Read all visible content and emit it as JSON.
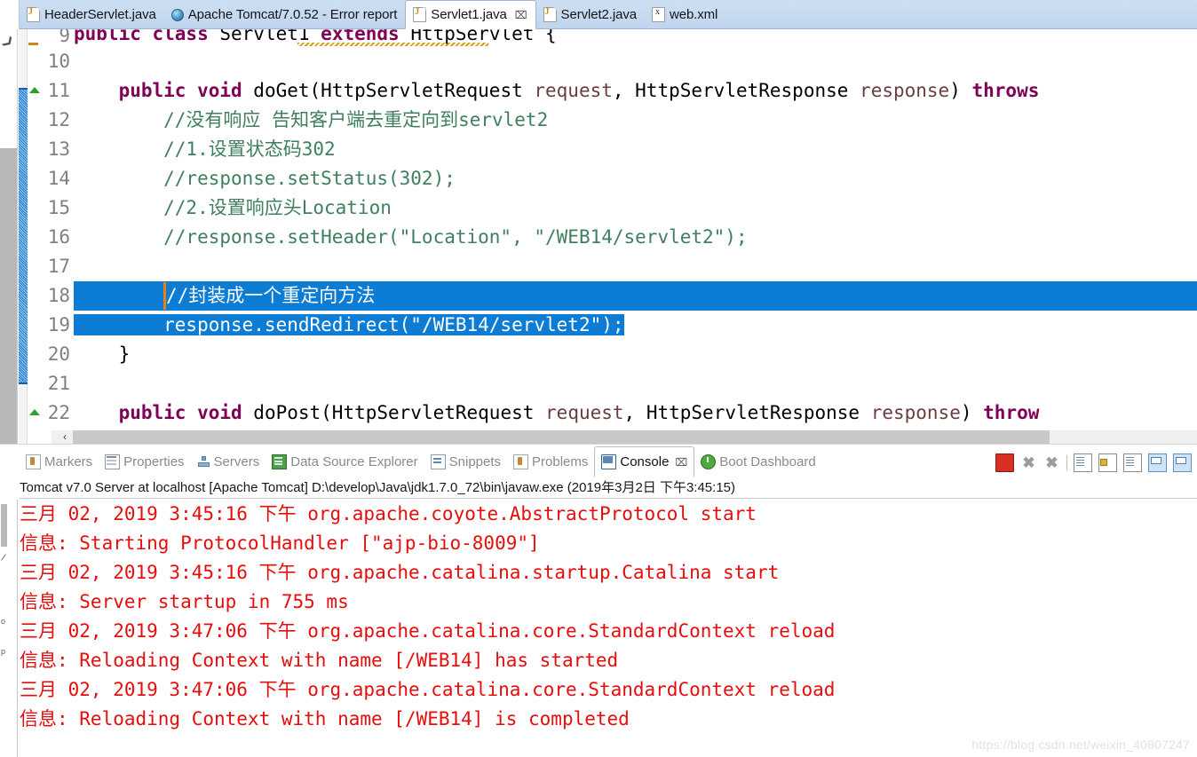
{
  "editor_tabs": [
    {
      "label": "HeaderServlet.java",
      "icon": "java-file-icon",
      "active": false,
      "closeable": false
    },
    {
      "label": "Apache Tomcat/7.0.52 - Error report",
      "icon": "web-browser-icon",
      "active": false,
      "closeable": false
    },
    {
      "label": "Servlet1.java",
      "icon": "java-file-icon",
      "active": true,
      "closeable": true,
      "close_glyph": "⌧"
    },
    {
      "label": "Servlet2.java",
      "icon": "java-file-icon",
      "active": false,
      "closeable": false
    },
    {
      "label": "web.xml",
      "icon": "xml-file-icon",
      "active": false,
      "closeable": false
    }
  ],
  "code": {
    "lines": [
      {
        "num": "9",
        "clipped": true,
        "segments": [
          {
            "text": "public class ",
            "style": "kw"
          },
          {
            "text": "Servlet1 ",
            "style": "plain"
          },
          {
            "text": "extends ",
            "style": "kw"
          },
          {
            "text": "HttpServlet {",
            "style": "plain"
          }
        ]
      },
      {
        "num": "10",
        "segments": []
      },
      {
        "num": "11",
        "fold": "arrow",
        "segments": [
          {
            "text": "    ",
            "style": "plain"
          },
          {
            "text": "public void ",
            "style": "kw"
          },
          {
            "text": "doGet(HttpServletRequest ",
            "style": "plain"
          },
          {
            "text": "request",
            "style": "param"
          },
          {
            "text": ", HttpServletResponse ",
            "style": "plain"
          },
          {
            "text": "response",
            "style": "param"
          },
          {
            "text": ") ",
            "style": "plain"
          },
          {
            "text": "throws",
            "style": "kw"
          }
        ]
      },
      {
        "num": "12",
        "segments": [
          {
            "text": "        //没有响应 告知客户端去重定向到servlet2",
            "style": "cmt"
          }
        ]
      },
      {
        "num": "13",
        "segments": [
          {
            "text": "        //1.设置状态码302",
            "style": "cmt"
          }
        ]
      },
      {
        "num": "14",
        "segments": [
          {
            "text": "        //response.setStatus(302);",
            "style": "cmt"
          }
        ]
      },
      {
        "num": "15",
        "segments": [
          {
            "text": "        //2.设置响应头Location",
            "style": "cmt"
          }
        ]
      },
      {
        "num": "16",
        "segments": [
          {
            "text": "        //response.setHeader(\"Location\", \"/WEB14/servlet2\");",
            "style": "cmt"
          }
        ]
      },
      {
        "num": "17",
        "segments": []
      },
      {
        "num": "18",
        "selected": "full",
        "caret": true,
        "segments": [
          {
            "text": "//封装成一个重定向方法",
            "style": "sel"
          }
        ]
      },
      {
        "num": "19",
        "selected": "text",
        "segments": [
          {
            "text": "        response.sendRedirect(\"/WEB14/servlet2\");",
            "style": "sel"
          }
        ]
      },
      {
        "num": "20",
        "segments": [
          {
            "text": "    }",
            "style": "plain"
          }
        ]
      },
      {
        "num": "21",
        "segments": []
      },
      {
        "num": "22",
        "fold": "arrow",
        "segments": [
          {
            "text": "    ",
            "style": "plain"
          },
          {
            "text": "public void ",
            "style": "kw"
          },
          {
            "text": "doPost(HttpServletRequest ",
            "style": "plain"
          },
          {
            "text": "request",
            "style": "param"
          },
          {
            "text": ", HttpServletResponse ",
            "style": "plain"
          },
          {
            "text": "response",
            "style": "param"
          },
          {
            "text": ") ",
            "style": "plain"
          },
          {
            "text": "throw",
            "style": "kw"
          }
        ]
      }
    ]
  },
  "view_tabs": [
    {
      "label": "Markers",
      "icon": "markers-icon",
      "active": false
    },
    {
      "label": "Properties",
      "icon": "properties-icon",
      "active": false
    },
    {
      "label": "Servers",
      "icon": "servers-icon",
      "active": false
    },
    {
      "label": "Data Source Explorer",
      "icon": "data-source-explorer-icon",
      "active": false
    },
    {
      "label": "Snippets",
      "icon": "snippets-icon",
      "active": false
    },
    {
      "label": "Problems",
      "icon": "problems-icon",
      "active": false
    },
    {
      "label": "Console",
      "icon": "console-icon",
      "active": true,
      "close_glyph": "⌧"
    },
    {
      "label": "Boot Dashboard",
      "icon": "boot-dashboard-icon",
      "active": false
    }
  ],
  "console_toolbar": [
    {
      "name": "terminate-button",
      "icon": "stop-square-icon"
    },
    {
      "name": "remove-launch-button",
      "icon": "x-icon",
      "glyph": "✖"
    },
    {
      "name": "remove-all-terminated-button",
      "icon": "double-x-icon",
      "glyph": "✖"
    },
    {
      "name": "toolbar-separator",
      "icon": "separator"
    },
    {
      "name": "clear-console-button",
      "icon": "clear-console-icon"
    },
    {
      "name": "scroll-lock-button",
      "icon": "lock-icon"
    },
    {
      "name": "word-wrap-button",
      "icon": "wrap-console-icon"
    },
    {
      "name": "pin-console-button",
      "icon": "pin-console-icon"
    },
    {
      "name": "display-selected-console-button",
      "icon": "display-console-icon"
    }
  ],
  "console": {
    "status": "Tomcat v7.0 Server at localhost [Apache Tomcat] D:\\develop\\Java\\jdk1.7.0_72\\bin\\javaw.exe (2019年3月2日 下午3:45:15)",
    "text_color": "#e60d0d",
    "lines": [
      "三月 02, 2019 3:45:16 下午 org.apache.coyote.AbstractProtocol start",
      "信息: Starting ProtocolHandler [\"ajp-bio-8009\"]",
      "三月 02, 2019 3:45:16 下午 org.apache.catalina.startup.Catalina start",
      "信息: Server startup in 755 ms",
      "三月 02, 2019 3:47:06 下午 org.apache.catalina.core.StandardContext reload",
      "信息: Reloading Context with name [/WEB14] has started",
      "三月 02, 2019 3:47:06 下午 org.apache.catalina.core.StandardContext reload",
      "信息: Reloading Context with name [/WEB14] is completed"
    ]
  },
  "scrollbar": {
    "left_arrow_glyph": "‹"
  },
  "watermark": "https://blog.csdn.net/weixin_40807247",
  "colors": {
    "selection": "#0c7cd5",
    "keyword": "#7f0055",
    "comment": "#3f7f5f",
    "parameter": "#6a3e3e",
    "console_red": "#e60d0d",
    "tabbar": "#c6daf0"
  }
}
